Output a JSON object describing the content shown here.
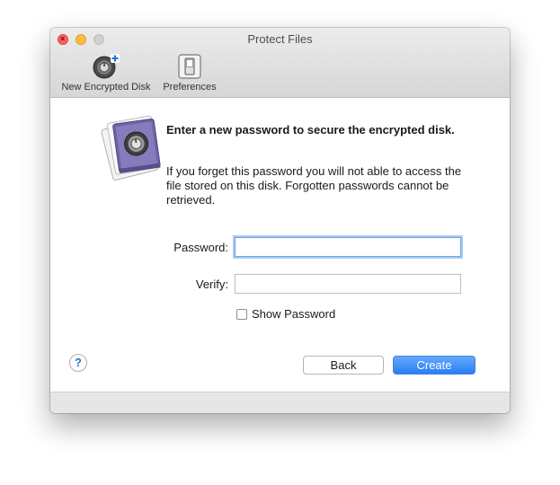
{
  "window": {
    "title": "Protect Files"
  },
  "toolbar": {
    "items": [
      {
        "label": "New Encrypted Disk",
        "icon": "encrypted-disk-add-icon"
      },
      {
        "label": "Preferences",
        "icon": "preferences-switch-icon"
      }
    ]
  },
  "dialog": {
    "heading": "Enter a new password to secure the encrypted disk.",
    "message": "If you forget this password you will not able to access the file stored on this disk. Forgotten passwords cannot be retrieved.",
    "password_label": "Password:",
    "password_value": "",
    "verify_label": "Verify:",
    "verify_value": "",
    "show_password_label": "Show Password",
    "show_password_checked": false,
    "help_label": "?",
    "back_label": "Back",
    "create_label": "Create"
  },
  "colors": {
    "accent": "#2a7ef3",
    "close_light": "#fc605c",
    "minimize_light": "#fdbc40",
    "zoom_light": "#d0d0d0",
    "disk_purple": "#6e64a8"
  }
}
